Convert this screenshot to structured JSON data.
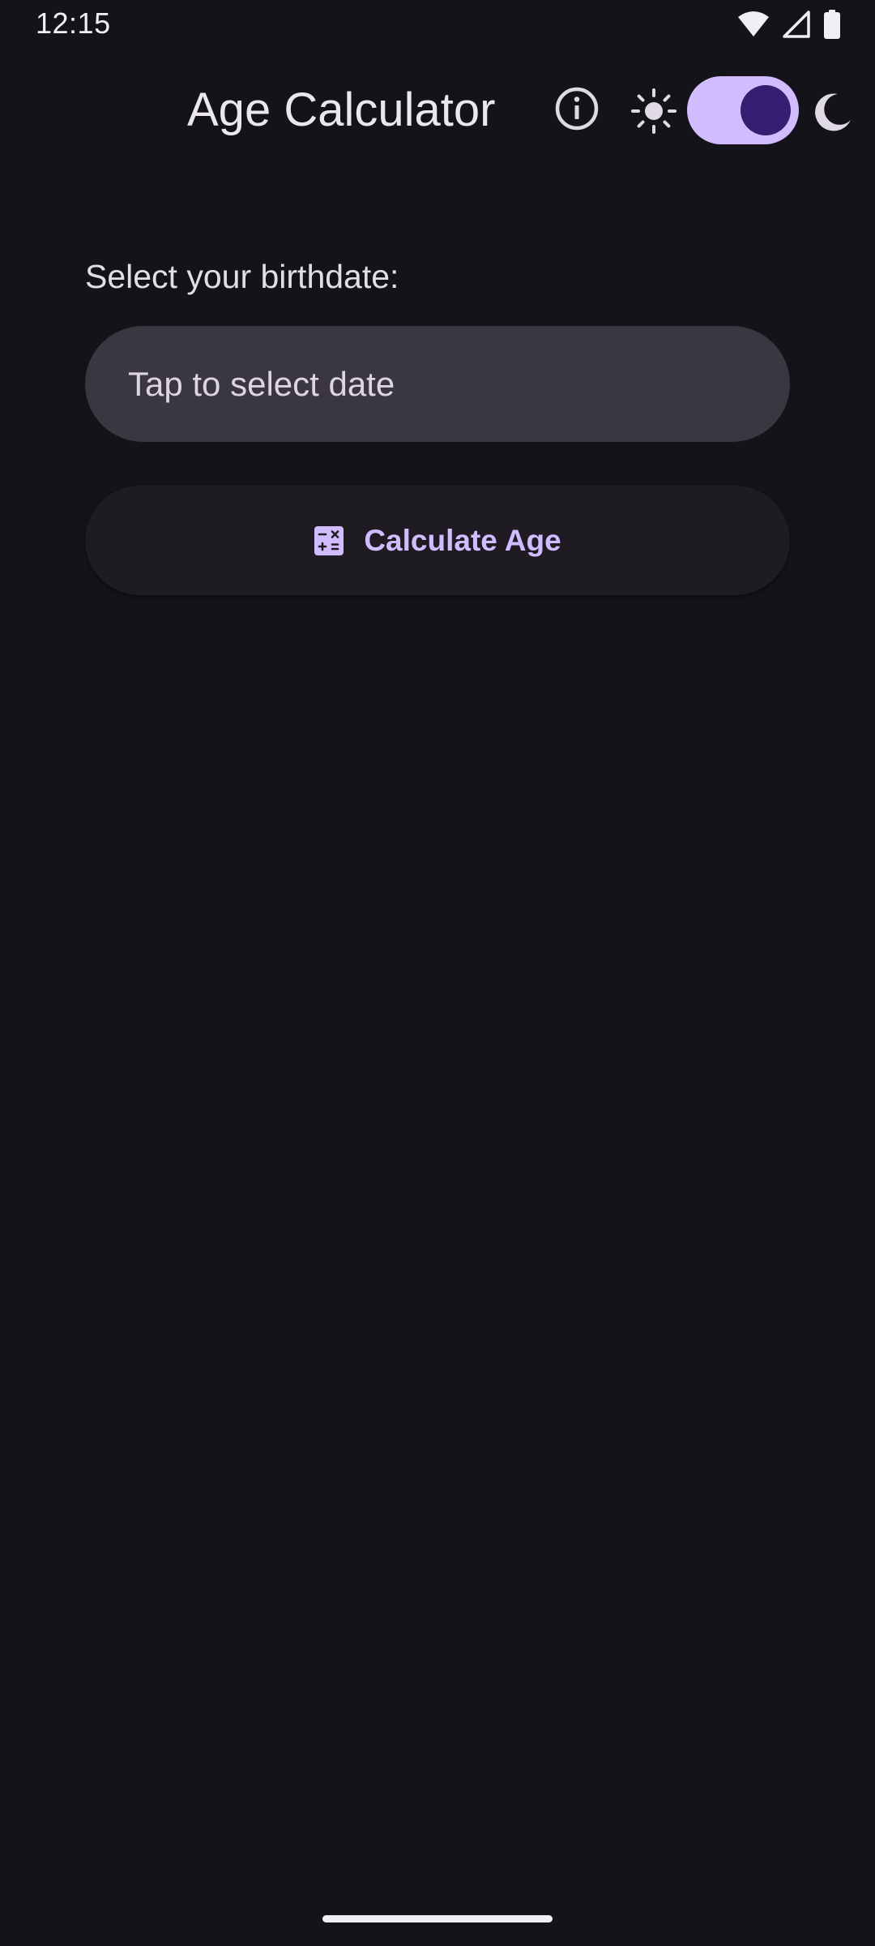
{
  "status_bar": {
    "time": "12:15",
    "icons": [
      "wifi-icon",
      "cellular-signal-icon",
      "battery-icon"
    ]
  },
  "app_bar": {
    "title": "Age Calculator",
    "info_icon": "info-icon",
    "light_icon": "sun-icon",
    "dark_icon": "moon-icon",
    "dark_mode_enabled": true
  },
  "form": {
    "prompt": "Select your birthdate:",
    "date_field_placeholder": "Tap to select date",
    "calculate_button_label": "Calculate Age",
    "calculate_button_icon": "calculator-icon"
  },
  "colors": {
    "background": "#15131a",
    "accent": "#d0bcfe",
    "accent_dark": "#381e72",
    "field_background": "#3a3740",
    "button_background": "#1e1b22"
  }
}
